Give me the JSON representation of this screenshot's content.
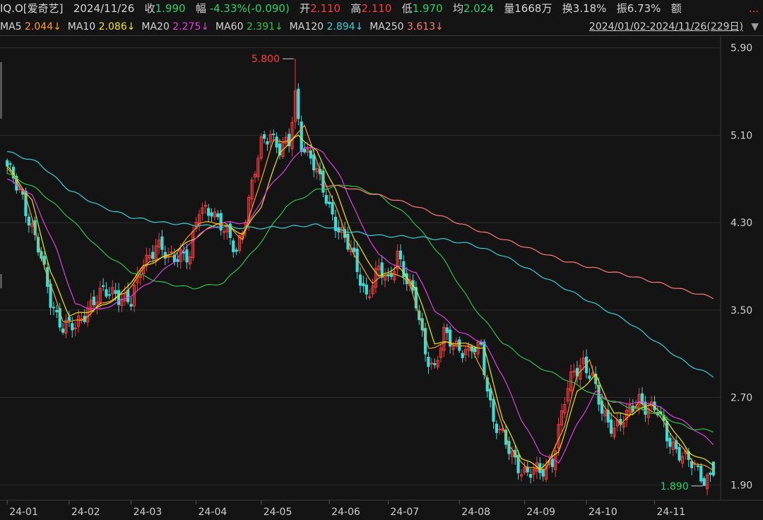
{
  "header": {
    "symbol": "IQ.O[爱奇艺]",
    "date": "2024/11/26",
    "close_label": "收",
    "close": "1.990",
    "chg_label": "幅",
    "chg": "-4.33%(-0.090)",
    "open_label": "开",
    "open": "2.110",
    "high_label": "高",
    "high": "2.110",
    "low_label": "低",
    "low": "1.970",
    "avg_label": "均",
    "avg": "2.024",
    "vol_label": "量",
    "vol": "1668万",
    "turnover_label": "换",
    "turnover": "3.18%",
    "amp_label": "振",
    "amp": "6.73%",
    "amount_label": "额",
    "more": "..."
  },
  "ma_bar": {
    "items": [
      {
        "label": "MA5",
        "value": "2.044",
        "arrow": "↓",
        "color": "#ff9f1a"
      },
      {
        "label": "MA10",
        "value": "2.086",
        "arrow": "↓",
        "color": "#f2e600"
      },
      {
        "label": "MA20",
        "value": "2.275",
        "arrow": "↓",
        "color": "#e43de4"
      },
      {
        "label": "MA60",
        "value": "2.391",
        "arrow": "↓",
        "color": "#2fc24a"
      },
      {
        "label": "MA120",
        "value": "2.894",
        "arrow": "↓",
        "color": "#39d0d6"
      },
      {
        "label": "MA250",
        "value": "3.613",
        "arrow": "↓",
        "color": "#ff7a7a"
      }
    ],
    "range": "2024/01/02-2024/11/26(229日)",
    "dropdown_icon": "triangle-down-icon"
  },
  "colors": {
    "up": "#ff3b3b",
    "down": "#3fdbd6",
    "grid": "#2c2c2c",
    "axis_text": "#cfcfcf",
    "background": "#141414"
  },
  "chart_data": {
    "type": "candlestick",
    "y_ticks": [
      1.9,
      2.7,
      3.5,
      4.3,
      5.1,
      5.9
    ],
    "y_tick_labels": [
      "1.90",
      "2.70",
      "3.50",
      "4.30",
      "5.10",
      "5.90"
    ],
    "ylim": [
      1.85,
      5.95
    ],
    "x_labels": [
      "24-01",
      "24-02",
      "24-03",
      "24-04",
      "24-05",
      "24-06",
      "24-07",
      "24-08",
      "24-09",
      "24-10",
      "24-11"
    ],
    "x_label_index": [
      0,
      20,
      40,
      61,
      82,
      104,
      123,
      146,
      167,
      187,
      209
    ],
    "n_days": 229,
    "high_annotation": {
      "label": "5.800",
      "value": 5.8,
      "index": 93
    },
    "low_annotation": {
      "label": "1.890",
      "value": 1.89,
      "index": 225
    },
    "close_anchors": [
      [
        0,
        4.78
      ],
      [
        5,
        4.55
      ],
      [
        10,
        4.05
      ],
      [
        14,
        3.6
      ],
      [
        18,
        3.35
      ],
      [
        22,
        3.32
      ],
      [
        26,
        3.55
      ],
      [
        30,
        3.62
      ],
      [
        35,
        3.68
      ],
      [
        40,
        3.55
      ],
      [
        44,
        3.95
      ],
      [
        48,
        4.1
      ],
      [
        52,
        3.95
      ],
      [
        56,
        4.05
      ],
      [
        59,
        3.98
      ],
      [
        62,
        4.4
      ],
      [
        66,
        4.45
      ],
      [
        70,
        4.2
      ],
      [
        74,
        4.05
      ],
      [
        78,
        4.5
      ],
      [
        82,
        5.0
      ],
      [
        85,
        5.15
      ],
      [
        88,
        4.98
      ],
      [
        91,
        5.0
      ],
      [
        93,
        5.45
      ],
      [
        95,
        5.05
      ],
      [
        98,
        4.9
      ],
      [
        101,
        4.65
      ],
      [
        104,
        4.45
      ],
      [
        108,
        4.2
      ],
      [
        112,
        3.95
      ],
      [
        116,
        3.65
      ],
      [
        120,
        3.85
      ],
      [
        123,
        3.75
      ],
      [
        126,
        4.05
      ],
      [
        129,
        3.75
      ],
      [
        132,
        3.55
      ],
      [
        135,
        3.15
      ],
      [
        138,
        2.95
      ],
      [
        141,
        3.25
      ],
      [
        145,
        3.2
      ],
      [
        149,
        3.1
      ],
      [
        153,
        3.15
      ],
      [
        157,
        2.5
      ],
      [
        161,
        2.25
      ],
      [
        165,
        2.1
      ],
      [
        168,
        2.0
      ],
      [
        172,
        2.0
      ],
      [
        176,
        2.15
      ],
      [
        180,
        2.65
      ],
      [
        183,
        2.95
      ],
      [
        186,
        3.05
      ],
      [
        189,
        2.85
      ],
      [
        192,
        2.55
      ],
      [
        196,
        2.45
      ],
      [
        200,
        2.5
      ],
      [
        204,
        2.7
      ],
      [
        207,
        2.62
      ],
      [
        210,
        2.55
      ],
      [
        213,
        2.35
      ],
      [
        216,
        2.25
      ],
      [
        219,
        2.12
      ],
      [
        222,
        2.05
      ],
      [
        225,
        1.98
      ],
      [
        228,
        1.99
      ]
    ],
    "ma_anchors": {
      "MA5": [
        [
          0,
          4.8
        ],
        [
          6,
          4.55
        ],
        [
          12,
          3.9
        ],
        [
          18,
          3.4
        ],
        [
          24,
          3.4
        ],
        [
          30,
          3.55
        ],
        [
          38,
          3.65
        ],
        [
          46,
          3.95
        ],
        [
          54,
          4.0
        ],
        [
          62,
          4.3
        ],
        [
          70,
          4.3
        ],
        [
          76,
          4.15
        ],
        [
          82,
          4.7
        ],
        [
          86,
          5.05
        ],
        [
          92,
          5.05
        ],
        [
          96,
          5.2
        ],
        [
          100,
          4.85
        ],
        [
          106,
          4.45
        ],
        [
          112,
          4.0
        ],
        [
          118,
          3.75
        ],
        [
          124,
          3.85
        ],
        [
          130,
          3.75
        ],
        [
          136,
          3.15
        ],
        [
          142,
          3.2
        ],
        [
          150,
          3.15
        ],
        [
          156,
          2.8
        ],
        [
          162,
          2.25
        ],
        [
          168,
          2.05
        ],
        [
          174,
          2.05
        ],
        [
          180,
          2.45
        ],
        [
          184,
          2.9
        ],
        [
          188,
          3.05
        ],
        [
          192,
          2.65
        ],
        [
          198,
          2.45
        ],
        [
          204,
          2.65
        ],
        [
          210,
          2.55
        ],
        [
          216,
          2.3
        ],
        [
          222,
          2.1
        ],
        [
          228,
          2.04
        ]
      ],
      "MA10": [
        [
          0,
          4.82
        ],
        [
          8,
          4.5
        ],
        [
          14,
          3.85
        ],
        [
          20,
          3.45
        ],
        [
          28,
          3.5
        ],
        [
          36,
          3.62
        ],
        [
          44,
          3.9
        ],
        [
          52,
          4.0
        ],
        [
          60,
          4.15
        ],
        [
          68,
          4.3
        ],
        [
          76,
          4.2
        ],
        [
          82,
          4.45
        ],
        [
          88,
          4.95
        ],
        [
          94,
          5.1
        ],
        [
          100,
          4.95
        ],
        [
          106,
          4.6
        ],
        [
          112,
          4.15
        ],
        [
          120,
          3.8
        ],
        [
          126,
          3.9
        ],
        [
          132,
          3.7
        ],
        [
          138,
          3.2
        ],
        [
          146,
          3.2
        ],
        [
          154,
          3.15
        ],
        [
          160,
          2.5
        ],
        [
          166,
          2.15
        ],
        [
          172,
          2.05
        ],
        [
          178,
          2.2
        ],
        [
          184,
          2.75
        ],
        [
          190,
          2.9
        ],
        [
          196,
          2.55
        ],
        [
          202,
          2.55
        ],
        [
          208,
          2.65
        ],
        [
          214,
          2.45
        ],
        [
          220,
          2.2
        ],
        [
          228,
          2.086
        ]
      ],
      "MA20": [
        [
          0,
          4.7
        ],
        [
          8,
          4.55
        ],
        [
          16,
          4.05
        ],
        [
          22,
          3.55
        ],
        [
          30,
          3.5
        ],
        [
          38,
          3.6
        ],
        [
          46,
          3.75
        ],
        [
          54,
          3.95
        ],
        [
          62,
          4.2
        ],
        [
          70,
          4.3
        ],
        [
          78,
          4.3
        ],
        [
          84,
          4.6
        ],
        [
          90,
          4.8
        ],
        [
          96,
          5.0
        ],
        [
          102,
          4.95
        ],
        [
          108,
          4.7
        ],
        [
          114,
          4.3
        ],
        [
          120,
          4.0
        ],
        [
          126,
          3.9
        ],
        [
          132,
          3.85
        ],
        [
          138,
          3.5
        ],
        [
          146,
          3.3
        ],
        [
          154,
          3.2
        ],
        [
          160,
          2.9
        ],
        [
          166,
          2.5
        ],
        [
          172,
          2.2
        ],
        [
          178,
          2.1
        ],
        [
          184,
          2.45
        ],
        [
          190,
          2.75
        ],
        [
          196,
          2.65
        ],
        [
          202,
          2.65
        ],
        [
          208,
          2.65
        ],
        [
          214,
          2.55
        ],
        [
          220,
          2.45
        ],
        [
          228,
          2.275
        ]
      ],
      "MA60": [
        [
          0,
          4.75
        ],
        [
          10,
          4.6
        ],
        [
          20,
          4.35
        ],
        [
          30,
          4.05
        ],
        [
          40,
          3.85
        ],
        [
          50,
          3.75
        ],
        [
          60,
          3.7
        ],
        [
          70,
          3.75
        ],
        [
          80,
          4.05
        ],
        [
          90,
          4.45
        ],
        [
          100,
          4.6
        ],
        [
          110,
          4.65
        ],
        [
          120,
          4.55
        ],
        [
          130,
          4.35
        ],
        [
          140,
          4.0
        ],
        [
          150,
          3.55
        ],
        [
          160,
          3.2
        ],
        [
          170,
          3.0
        ],
        [
          180,
          2.87
        ],
        [
          190,
          2.72
        ],
        [
          200,
          2.62
        ],
        [
          210,
          2.55
        ],
        [
          220,
          2.42
        ],
        [
          228,
          2.391
        ]
      ],
      "MA120": [
        [
          0,
          4.95
        ],
        [
          10,
          4.85
        ],
        [
          20,
          4.6
        ],
        [
          30,
          4.45
        ],
        [
          40,
          4.35
        ],
        [
          50,
          4.3
        ],
        [
          60,
          4.28
        ],
        [
          70,
          4.26
        ],
        [
          80,
          4.25
        ],
        [
          90,
          4.26
        ],
        [
          100,
          4.28
        ],
        [
          110,
          4.22
        ],
        [
          120,
          4.18
        ],
        [
          130,
          4.17
        ],
        [
          140,
          4.15
        ],
        [
          150,
          4.1
        ],
        [
          160,
          4.0
        ],
        [
          170,
          3.85
        ],
        [
          180,
          3.7
        ],
        [
          190,
          3.55
        ],
        [
          200,
          3.4
        ],
        [
          210,
          3.2
        ],
        [
          220,
          3.0
        ],
        [
          228,
          2.894
        ]
      ],
      "MA250": [
        [
          101,
          4.65
        ],
        [
          110,
          4.62
        ],
        [
          120,
          4.55
        ],
        [
          130,
          4.47
        ],
        [
          140,
          4.36
        ],
        [
          150,
          4.25
        ],
        [
          160,
          4.15
        ],
        [
          170,
          4.05
        ],
        [
          180,
          3.95
        ],
        [
          190,
          3.88
        ],
        [
          200,
          3.82
        ],
        [
          210,
          3.75
        ],
        [
          220,
          3.67
        ],
        [
          228,
          3.613
        ]
      ]
    },
    "ma_colors": {
      "MA5": "#ff9f1a",
      "MA10": "#f2e600",
      "MA20": "#e43de4",
      "MA60": "#2fc24a",
      "MA120": "#39d0d6",
      "MA250": "#ff7a7a"
    },
    "grid": true
  }
}
